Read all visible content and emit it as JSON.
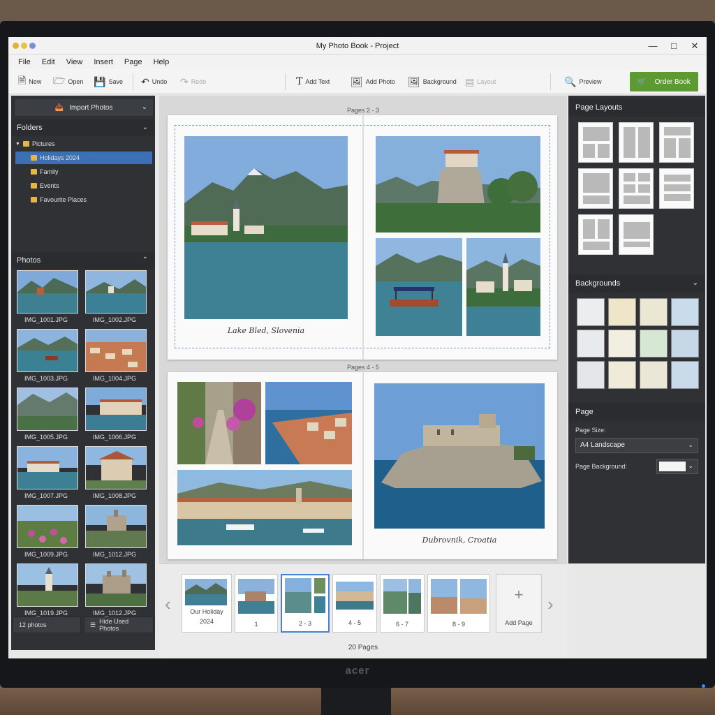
{
  "window": {
    "title": "My Photo Book - Project"
  },
  "menu": [
    "File",
    "Edit",
    "View",
    "Insert",
    "Page",
    "Help"
  ],
  "toolbar": {
    "new": "New",
    "open": "Open",
    "save": "Save",
    "undo": "Undo",
    "redo": "Redo",
    "add_text": "Add Text",
    "add_photo": "Add Photo",
    "background": "Background",
    "layout": "Layout",
    "preview": "Preview",
    "order": "Order Book"
  },
  "left": {
    "import": "Import Photos",
    "folders_title": "Folders",
    "folders": [
      "Pictures",
      "Holidays 2024",
      "Family",
      "Events",
      "Favourite Places"
    ],
    "photos_title": "Photos",
    "photos": [
      "IMG_1001.JPG",
      "IMG_1002.JPG",
      "IMG_1003.JPG",
      "IMG_1004.JPG",
      "IMG_1005.JPG",
      "IMG_1006.JPG",
      "IMG_1007.JPG",
      "IMG_1008.JPG",
      "IMG_1009.JPG",
      "IMG_1012.JPG",
      "IMG_1019.JPG",
      "IMG_1012.JPG"
    ],
    "count": "12 photos",
    "hide_used": "Hide Used Photos"
  },
  "center": {
    "spread1_label": "Pages 2 - 3",
    "spread1_caption": "Lake Bled, Slovenia",
    "spread2_label": "Pages 4 - 5",
    "spread2_caption": "Dubrovnik, Croatia"
  },
  "filmstrip": {
    "items": [
      "Our Holiday",
      "2024",
      "1",
      "2 - 3",
      "4 - 5",
      "6 - 7",
      "8 - 9",
      "Add Page"
    ],
    "total": "20 Pages"
  },
  "right": {
    "layouts_title": "Page Layouts",
    "backgrounds_title": "Backgrounds",
    "backgrounds": [
      "#ecedee",
      "#efe6c9",
      "#ece7d4",
      "#c9dceb",
      "#e8ebee",
      "#f2eee2",
      "#d6e8d4",
      "#c6d8e8",
      "#e4e6ea",
      "#f0ead8",
      "#ece6d6",
      "#c9dbeb"
    ],
    "page_title": "Page",
    "page_size_label": "Page Size:",
    "page_size_value": "A4 Landscape",
    "page_bg_label": "Page Background:"
  },
  "colors": {
    "accent": "#5e9a32",
    "selection": "#3d6fb4",
    "panel": "#2f3135"
  },
  "monitor": {
    "brand": "acer"
  }
}
